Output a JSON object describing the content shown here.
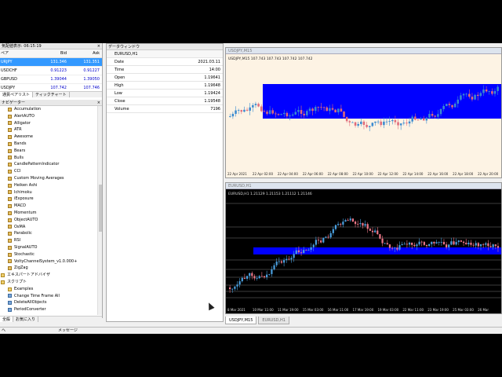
{
  "market_watch": {
    "title": "気配値表示: 06:15:19",
    "close": "×",
    "headers": [
      "ペア",
      "Bid",
      "Ask"
    ],
    "rows": [
      {
        "symbol": "URJPY",
        "bid": "131.346",
        "ask": "131.351",
        "selected": true
      },
      {
        "symbol": "USDCHF",
        "bid": "0.91223",
        "ask": "0.91227",
        "selected": false
      },
      {
        "symbol": "GBPUSD",
        "bid": "1.39044",
        "ask": "1.39050",
        "selected": false
      },
      {
        "symbol": "USDJPY",
        "bid": "107.742",
        "ask": "107.746",
        "selected": false
      }
    ],
    "tabs": [
      "通貨ペアリスト",
      "ティックチャート"
    ]
  },
  "navigator": {
    "title": "ナビゲーター",
    "close": "×",
    "items": [
      {
        "label": "Accumulation",
        "type": "indicator",
        "level": 1
      },
      {
        "label": "AlertAUTO",
        "type": "indicator",
        "level": 1
      },
      {
        "label": "Alligator",
        "type": "indicator",
        "level": 1
      },
      {
        "label": "ATR",
        "type": "indicator",
        "level": 1
      },
      {
        "label": "Awesome",
        "type": "indicator",
        "level": 1
      },
      {
        "label": "Bands",
        "type": "indicator",
        "level": 1
      },
      {
        "label": "Bears",
        "type": "indicator",
        "level": 1
      },
      {
        "label": "Bulls",
        "type": "indicator",
        "level": 1
      },
      {
        "label": "CandlePatternIndicator",
        "type": "indicator",
        "level": 1
      },
      {
        "label": "CCI",
        "type": "indicator",
        "level": 1
      },
      {
        "label": "Custom Moving Averages",
        "type": "indicator",
        "level": 1
      },
      {
        "label": "Heiken Ashi",
        "type": "indicator",
        "level": 1
      },
      {
        "label": "Ichimoku",
        "type": "indicator",
        "level": 1
      },
      {
        "label": "iExposure",
        "type": "indicator",
        "level": 1
      },
      {
        "label": "MACD",
        "type": "indicator",
        "level": 1
      },
      {
        "label": "Momentum",
        "type": "indicator",
        "level": 1
      },
      {
        "label": "ObjectAUTO",
        "type": "indicator",
        "level": 1
      },
      {
        "label": "OsMA",
        "type": "indicator",
        "level": 1
      },
      {
        "label": "Parabolic",
        "type": "indicator",
        "level": 1
      },
      {
        "label": "RSI",
        "type": "indicator",
        "level": 1
      },
      {
        "label": "SignalAUTO",
        "type": "indicator",
        "level": 1
      },
      {
        "label": "Stochastic",
        "type": "indicator",
        "level": 1
      },
      {
        "label": "VoltyChannelSystem_v1.0.000+",
        "type": "indicator",
        "level": 1
      },
      {
        "label": "ZigZag",
        "type": "indicator",
        "level": 1
      },
      {
        "label": "エキスパートアドバイザ",
        "type": "folder",
        "level": 0
      },
      {
        "label": "スクリプト",
        "type": "folder",
        "level": 0
      },
      {
        "label": "Examples",
        "type": "folder",
        "level": 1
      },
      {
        "label": "Change Time Frame All",
        "type": "script",
        "level": 1
      },
      {
        "label": "DeleteAllObjects",
        "type": "script",
        "level": 1
      },
      {
        "label": "PeriodConverter",
        "type": "script",
        "level": 1
      }
    ],
    "tabs": [
      "全般",
      "お気に入り"
    ]
  },
  "data_window": {
    "title": "データウィンドウ",
    "symbol": "EURUSD,H1",
    "rows": [
      {
        "key": "Date",
        "value": "2021.03.11"
      },
      {
        "key": "Time",
        "value": "14:00"
      },
      {
        "key": "Open",
        "value": "1.19641"
      },
      {
        "key": "High",
        "value": "1.19648"
      },
      {
        "key": "Low",
        "value": "1.19424"
      },
      {
        "key": "Close",
        "value": "1.19548"
      },
      {
        "key": "Volume",
        "value": "7196"
      }
    ]
  },
  "chart1": {
    "window_title": "USDJPY,M15",
    "info": "USDJPY,M15  107.743 107.743 107.742 107.742",
    "xlabels": [
      "22 Apr 2021",
      "22 Apr 02:00",
      "22 Apr 04:00",
      "22 Apr 06:00",
      "22 Apr 08:00",
      "22 Apr 10:00",
      "22 Apr 12:00",
      "22 Apr 14:00",
      "22 Apr 16:00",
      "22 Apr 18:00",
      "22 Apr 20:00"
    ],
    "bg": "#fdf3e4",
    "zone_color": "#0000ff",
    "up_color": "#3a8bd0",
    "down_color": "#e06b7a"
  },
  "chart2": {
    "window_title": "EURUSD,H1",
    "info": "EURUSD,H1  1.21129 1.21153 1.21112 1.21146",
    "xlabels": [
      "8 Mar 2021",
      "10 Mar 11:00",
      "11 Mar 19:00",
      "15 Mar 03:00",
      "16 Mar 11:00",
      "17 Mar 19:00",
      "19 Mar 03:00",
      "22 Mar 11:00",
      "23 Mar 19:00",
      "25 Mar 03:00",
      "26 Mar"
    ],
    "bg": "#000000",
    "zone_color": "#0000ff",
    "up_color": "#4aa0e0",
    "down_color": "#ee7788"
  },
  "chart_tabs": [
    "USDJPY,M15",
    "EURUSD,H1"
  ],
  "status": {
    "left": "ヘ",
    "mid": "メッセージ"
  }
}
